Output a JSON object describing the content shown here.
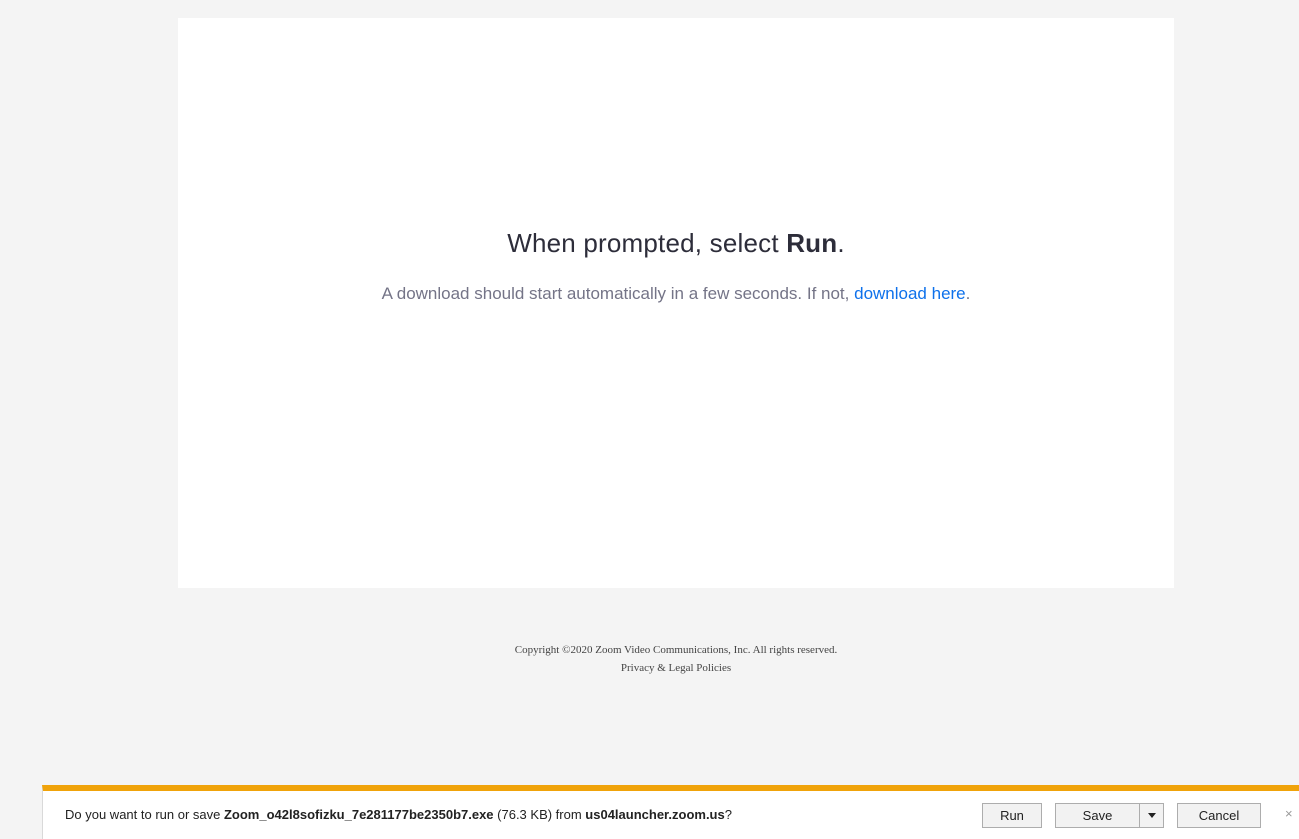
{
  "page": {
    "heading_prefix": "When prompted, select ",
    "heading_bold": "Run",
    "heading_suffix": ".",
    "subtext": "A download should start automatically in a few seconds. If not, ",
    "download_link": "download here",
    "subtext_end": "."
  },
  "footer": {
    "copyright": "Copyright ©2020 Zoom Video Communications, Inc. All rights reserved.",
    "privacy_link": "Privacy & Legal Policies"
  },
  "download_bar": {
    "prompt_prefix": "Do you want to run or save ",
    "file_name": "Zoom_o42l8sofizku_7e281177be2350b7.exe",
    "file_size": " (76.3 KB) from ",
    "source": "us04launcher.zoom.us",
    "prompt_suffix": "?",
    "run_label": "Run",
    "save_label": "Save",
    "cancel_label": "Cancel",
    "close_glyph": "×"
  },
  "colors": {
    "accent_bar": "#f0a30a",
    "link": "#0e71eb"
  }
}
